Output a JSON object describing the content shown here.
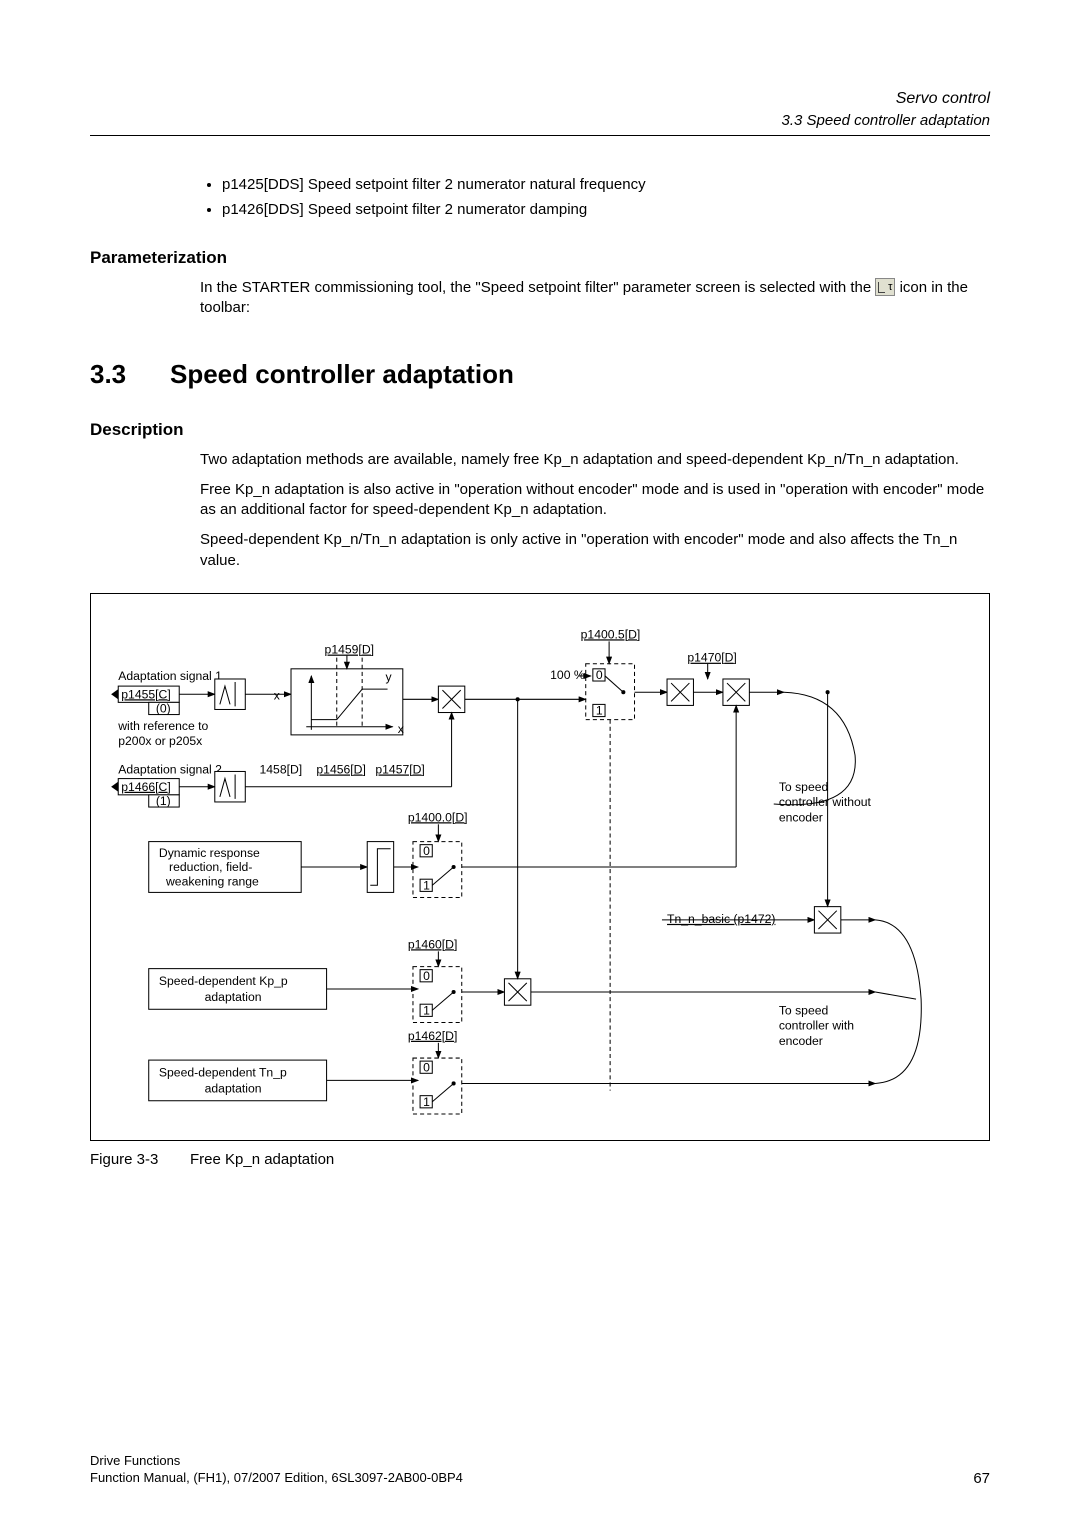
{
  "header": {
    "title": "Servo control",
    "subtitle": "3.3 Speed controller adaptation"
  },
  "bullets": [
    "p1425[DDS] Speed setpoint filter 2 numerator natural frequency",
    "p1426[DDS] Speed setpoint filter 2 numerator damping"
  ],
  "param_heading": "Parameterization",
  "param_text_1": "In the STARTER commissioning tool, the \"Speed setpoint filter\" parameter screen is selected with the ",
  "param_text_2": " icon in the toolbar:",
  "section": {
    "number": "3.3",
    "title": "Speed controller adaptation"
  },
  "desc_heading": "Description",
  "desc_p1": "Two adaptation methods are available, namely free Kp_n adaptation and speed-dependent Kp_n/Tn_n adaptation.",
  "desc_p2": "Free Kp_n adaptation is also active in \"operation without encoder\" mode and is used in \"operation with encoder\" mode as an additional factor for speed-dependent Kp_n adaptation.",
  "desc_p3": "Speed-dependent Kp_n/Tn_n adaptation is only active in \"operation with encoder\" mode and also affects the Tn_n value.",
  "figure": {
    "labels": {
      "p1459": "p1459[D]",
      "p1400_5": "p1400.5[D]",
      "p1470": "p1470[D]",
      "adapt1": "Adaptation signal 1",
      "p1455": "p1455[C]",
      "zero": "(0)",
      "one": "(1)",
      "ref": "with reference to p200x or p205x",
      "adapt2": "Adaptation signal 2",
      "p1458": "1458[D]",
      "p1456": "p1456[D]",
      "p1457": "p1457[D]",
      "p1466": "p1466[C]",
      "dyn": "Dynamic response reduction, field-weakening range",
      "p1400_0": "p1400.0[D]",
      "p1460": "p1460[D]",
      "kp_adapt": "Speed-dependent Kp_p adaptation",
      "p1462": "p1462[D]",
      "tn_adapt": "Speed-dependent Tn_p adaptation",
      "to_noenc": "To speed controller without encoder",
      "tn_basic": "Tn_n_basic (p1472)",
      "to_enc": "To speed controller with encoder",
      "hundred": "100 %",
      "y": "y",
      "x1": "x",
      "x2": "x",
      "sw0": "0",
      "sw1": "1"
    },
    "caption_label": "Figure 3-3",
    "caption_text": "Free Kp_n adaptation"
  },
  "footer": {
    "line1": "Drive Functions",
    "line2": "Function Manual, (FH1), 07/2007 Edition, 6SL3097-2AB00-0BP4",
    "page": "67"
  }
}
